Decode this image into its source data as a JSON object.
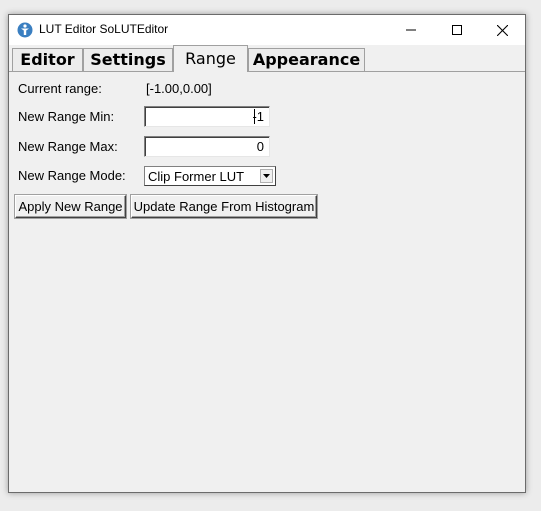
{
  "window": {
    "title": "LUT Editor SoLUTEditor",
    "controls": {
      "minimize_icon": "minimize-icon",
      "maximize_icon": "maximize-icon",
      "close_icon": "close-icon"
    },
    "app_icon": "app-icon"
  },
  "tabs": [
    {
      "label": "Editor",
      "active": false
    },
    {
      "label": "Settings",
      "active": false
    },
    {
      "label": "Range",
      "active": true
    },
    {
      "label": "Appearance",
      "active": false
    }
  ],
  "range_tab": {
    "current_range_label": "Current range:",
    "current_range_value": "[-1.00,0.00]",
    "min_label": "New Range Min:",
    "min_value": "-1",
    "max_label": "New Range Max:",
    "max_value": "0",
    "mode_label": "New Range Mode:",
    "mode_value": "Clip Former LUT",
    "apply_button": "Apply New Range",
    "update_button": "Update Range From Histogram"
  },
  "colors": {
    "window_bg": "#f0f0f0",
    "titlebar_bg": "#ffffff",
    "app_icon_color": "#3a7fc1"
  }
}
